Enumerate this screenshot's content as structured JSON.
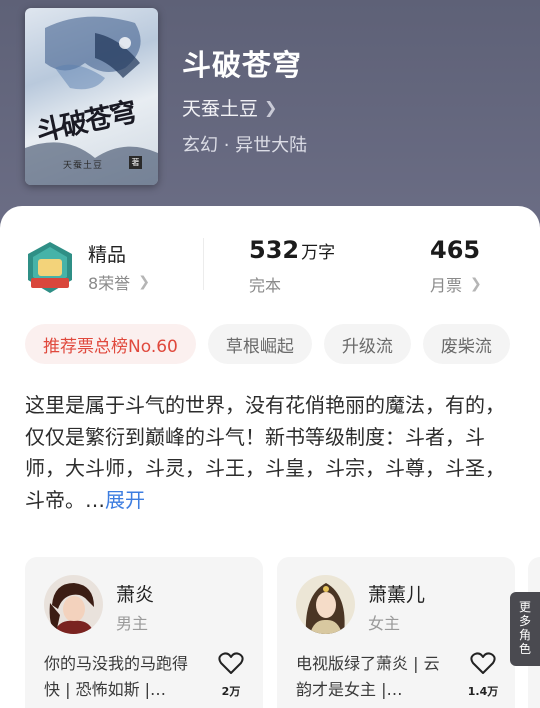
{
  "book": {
    "title": "斗破苍穹",
    "author": "天蚕土豆",
    "genre": "玄幻 · 异世大陆",
    "cover": {
      "title_art": "斗破苍穹",
      "author_art": "天蚕土豆",
      "seal": "著"
    }
  },
  "stats": {
    "quality_label": "精品",
    "honors": "8荣誉",
    "word_count": "532",
    "word_unit": "万字",
    "status": "完本",
    "monthly_votes": "465",
    "monthly_label": "月票"
  },
  "tags": [
    "推荐票总榜No.60",
    "草根崛起",
    "升级流",
    "废柴流"
  ],
  "description": {
    "text": "这里是属于斗气的世界，没有花俏艳丽的魔法，有的，仅仅是繁衍到巅峰的斗气！新书等级制度：斗者，斗师，大斗师，斗灵，斗王，斗皇，斗宗，斗尊，斗圣，斗帝。…",
    "expand_label": "展开"
  },
  "characters": [
    {
      "name": "萧炎",
      "role": "男主",
      "desc": "你的马没我的马跑得快 | 恐怖如斯 |…",
      "likes": "2万"
    },
    {
      "name": "萧薰儿",
      "role": "女主",
      "desc": "电视版绿了萧炎 | 云韵才是女主 |…",
      "likes": "1.4万"
    }
  ],
  "more_characters": "更多角色",
  "colors": {
    "header_bg": "#6a6c83",
    "accent_red": "#e0493d",
    "link_blue": "#3d7de0"
  }
}
